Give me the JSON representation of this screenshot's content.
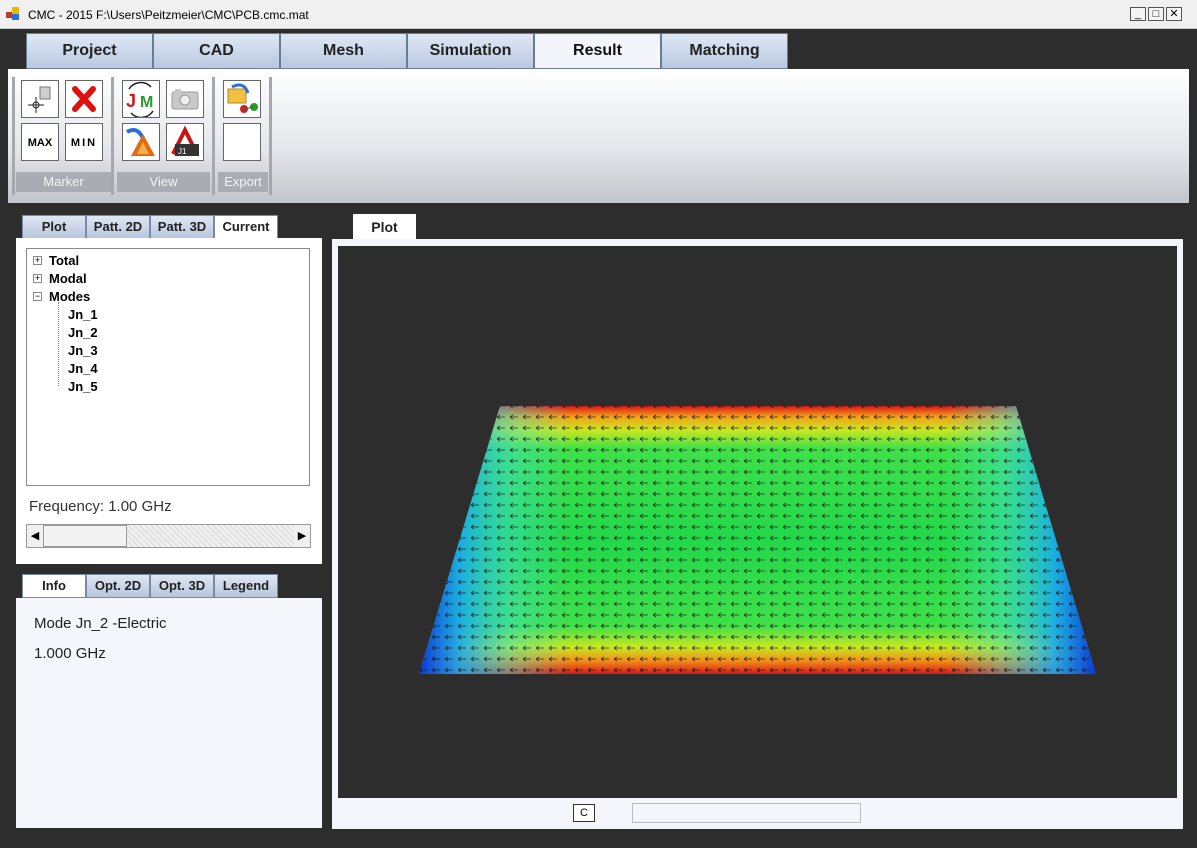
{
  "window": {
    "title": "CMC - 2015 F:\\Users\\Peitzmeier\\CMC\\PCB.cmc.mat",
    "minimize": "_",
    "maximize": "□",
    "close": "✕"
  },
  "main_tabs": [
    "Project",
    "CAD",
    "Mesh",
    "Simulation",
    "Result",
    "Matching"
  ],
  "ribbon": {
    "groups": [
      "Marker",
      "View",
      "Export"
    ],
    "buttons": {
      "max_label": "MAX",
      "min_label": "MIN"
    }
  },
  "left_tabs": [
    "Plot",
    "Patt. 2D",
    "Patt. 3D",
    "Current"
  ],
  "tree": {
    "nodes": [
      "Total",
      "Modal",
      "Modes"
    ],
    "modes": [
      "Jn_1",
      "Jn_2",
      "Jn_3",
      "Jn_4",
      "Jn_5"
    ]
  },
  "frequency_label": "Frequency: 1.00 GHz",
  "slider": {
    "position": 0.0
  },
  "bottom_tabs": [
    "Info",
    "Opt. 2D",
    "Opt. 3D",
    "Legend"
  ],
  "info": {
    "mode": "Mode Jn_2 -Electric",
    "frequency": "1.000 GHz"
  },
  "plot_tab": "Plot",
  "plot_footer": {
    "button": "C"
  },
  "colors": {
    "background": "#2d2d2d",
    "panel": "#f4f6fb",
    "tab_gradient_top": "#dfe8f5",
    "tab_gradient_bottom": "#b9c8e0"
  }
}
